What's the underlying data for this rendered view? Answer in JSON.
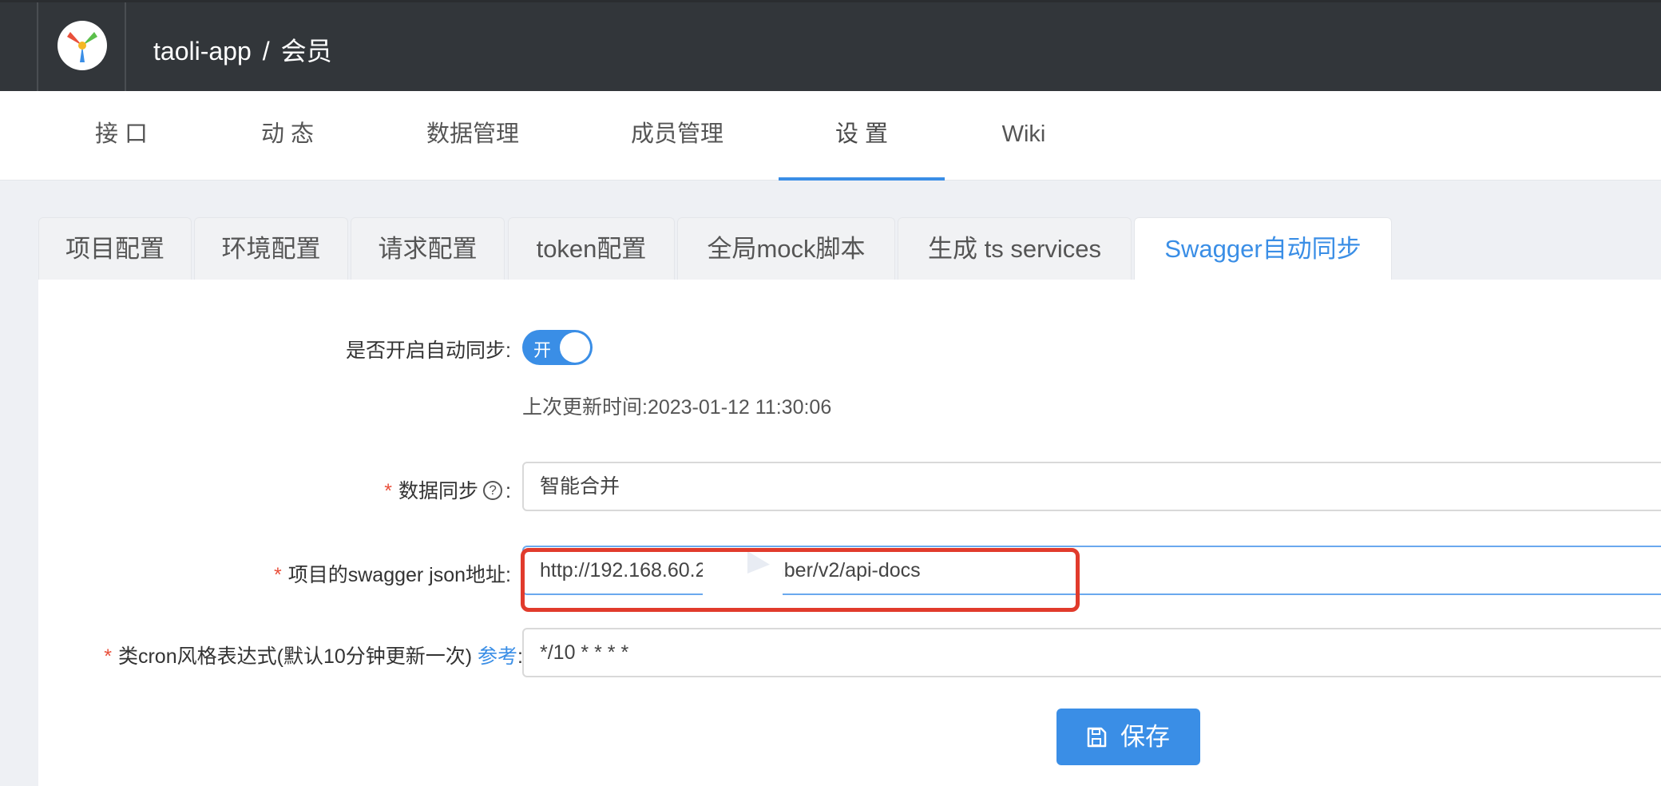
{
  "header": {
    "project": "taoli-app",
    "separator": "/",
    "group": "会员"
  },
  "nav": {
    "items": [
      {
        "label": "接 口"
      },
      {
        "label": "动 态"
      },
      {
        "label": "数据管理"
      },
      {
        "label": "成员管理"
      },
      {
        "label": "设 置",
        "active": true
      },
      {
        "label": "Wiki"
      }
    ]
  },
  "settings_tabs": [
    {
      "label": "项目配置"
    },
    {
      "label": "环境配置"
    },
    {
      "label": "请求配置"
    },
    {
      "label": "token配置"
    },
    {
      "label": "全局mock脚本"
    },
    {
      "label": "生成 ts services"
    },
    {
      "label": "Swagger自动同步",
      "active": true
    }
  ],
  "form": {
    "auto_sync_label": "是否开启自动同步",
    "toggle_text": "开",
    "last_update": "上次更新时间:2023-01-12 11:30:06",
    "data_sync_label": "数据同步",
    "data_sync_value": "智能合并",
    "swagger_url_label": "项目的swagger json地址",
    "swagger_url_value": "http://192.168.60.2        73/member/v2/api-docs",
    "cron_label": "类cron风格表达式(默认10分钟更新一次)",
    "cron_link": "参考",
    "cron_value": "*/10 * * * *",
    "required_mark": "*",
    "colon": ":",
    "help_glyph": "?"
  },
  "actions": {
    "save_label": "保存"
  },
  "colors": {
    "accent": "#3a8ee6",
    "header_bg": "#32363a",
    "highlight_box": "#e13b2c"
  }
}
